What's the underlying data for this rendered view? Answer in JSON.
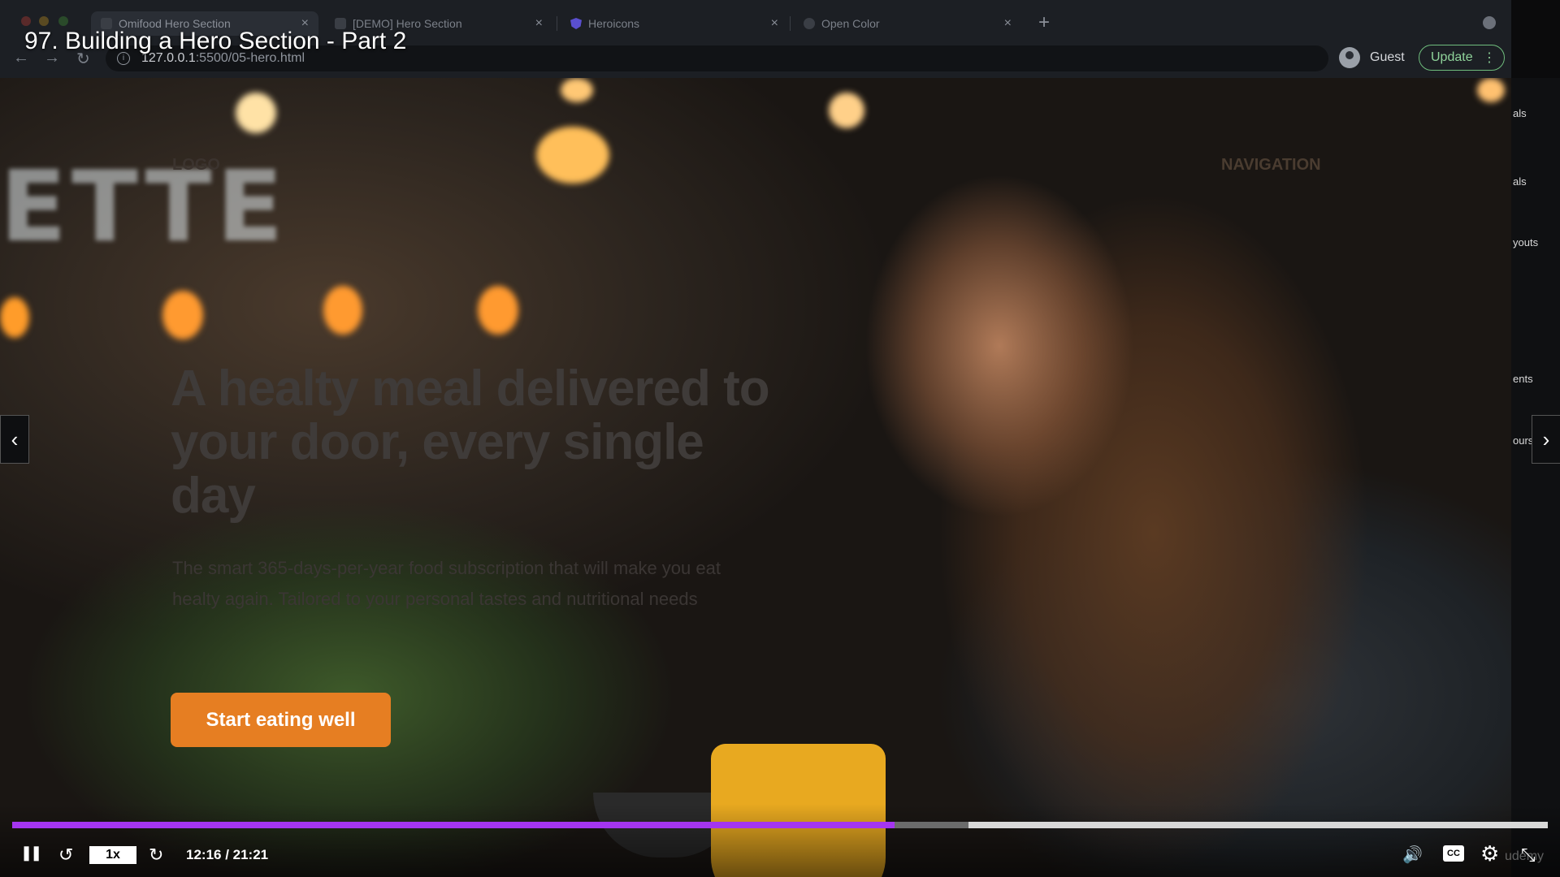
{
  "course_title": "97. Building a Hero Section - Part 2",
  "browser": {
    "tabs": [
      {
        "label": "Omifood Hero Section",
        "active": true,
        "close": "×"
      },
      {
        "label": "[DEMO] Hero Section",
        "active": false,
        "close": "×"
      },
      {
        "label": "Heroicons",
        "active": false,
        "close": "×"
      },
      {
        "label": "Open Color",
        "active": false,
        "close": "×"
      }
    ],
    "new_tab": "+",
    "url_host": "127.0.0.1",
    "url_path": ":5500/05-hero.html",
    "profile_label": "Guest",
    "update_label": "Update",
    "update_menu": "⋮",
    "back": "←",
    "forward": "→",
    "reload": "↻",
    "info": "i"
  },
  "page": {
    "logo": "LOGO",
    "navigation": "NAVIGATION",
    "hero_title": "A healty meal delivered to your door, every single day",
    "hero_text": "The smart 365-days-per-year food subscription that will make you eat healty again. Tailored to your personal tastes and nutritional needs",
    "cta_label": "Start eating well",
    "neon_sign": "ETTE"
  },
  "sidebar_peek": [
    "als",
    "als",
    "youts",
    "ents",
    "ours"
  ],
  "player": {
    "prev_arrow": "‹",
    "next_arrow": "›",
    "speed_label": "1x",
    "time_label": "12:16 / 21:21",
    "played_fraction": 0.5746,
    "buffered_fraction": 0.6225,
    "pause_icon": "❚❚",
    "rewind_icon": "↺",
    "forward_icon": "↻",
    "volume_icon": "🔊",
    "cc_label": "CC",
    "settings_icon": "⚙",
    "exit_fullscreen_icon": "⤡",
    "watermark": "udemy"
  },
  "colors": {
    "progress_played": "#a435f0",
    "cta": "#e67e22",
    "update_border": "#6fbd7d"
  }
}
